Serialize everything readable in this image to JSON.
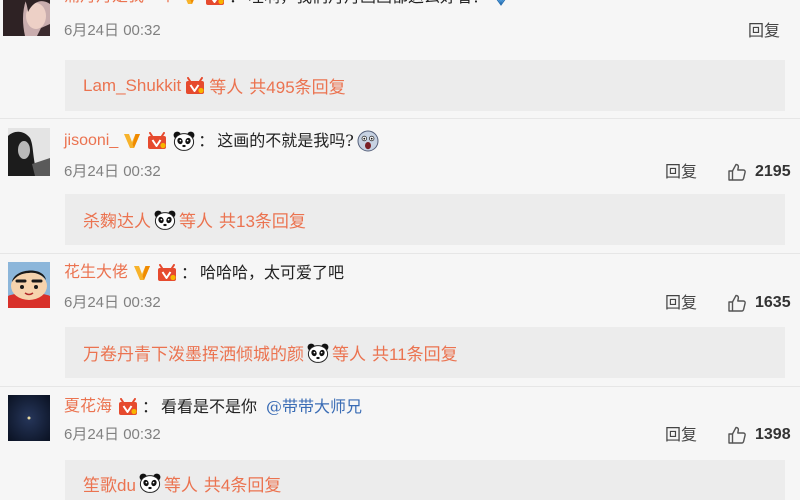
{
  "colors": {
    "page_bg": "#f6f6f6",
    "reply_box_bg": "#ececec",
    "username": "#eb7350",
    "text": "#222222",
    "meta": "#808080",
    "action": "#444444",
    "mention": "#3a6cb5"
  },
  "comments": [
    {
      "username": "蒲丹丹是我一个",
      "badges": [
        "verified-v-icon",
        "member-badge-icon"
      ],
      "separator": "：",
      "text": "哇啊，我们丹丹画画都这么好看！",
      "trailing_emoji": "diamond-emoji-icon",
      "date": "6月24日 00:32",
      "reply_label": "回复",
      "replies": {
        "first_user": "Lam_Shukkit",
        "first_user_badge": "member-badge-icon",
        "others_label": "等人",
        "count_label": "共495条回复"
      }
    },
    {
      "username": "jisooni_",
      "badges": [
        "verified-v-icon",
        "member-badge-icon",
        "panda-emoji-icon"
      ],
      "separator": "：",
      "text": "这画的不就是我吗?",
      "trailing_emoji": "shocked-face-emoji-icon",
      "date": "6月24日 00:32",
      "reply_label": "回复",
      "like_icon": "thumbs-up-icon",
      "likes": "2195",
      "replies": {
        "first_user": "杀麴达人",
        "first_user_badge": "panda-emoji-icon",
        "others_label": "等人",
        "count_label": "共13条回复"
      }
    },
    {
      "username": "花生大佬",
      "badges": [
        "verified-v-icon",
        "member-badge-icon"
      ],
      "separator": "：",
      "text": "哈哈哈，太可爱了吧",
      "date": "6月24日 00:32",
      "reply_label": "回复",
      "like_icon": "thumbs-up-icon",
      "likes": "1635",
      "replies": {
        "first_user": "万卷丹青下泼墨挥洒倾城的颜",
        "first_user_badge": "panda-emoji-icon",
        "others_label": "等人",
        "count_label": "共11条回复"
      }
    },
    {
      "username": "夏花海",
      "badges": [
        "member-badge-icon"
      ],
      "separator": "：",
      "text": "看看是不是你",
      "mention": "@带带大师兄",
      "date": "6月24日 00:32",
      "reply_label": "回复",
      "like_icon": "thumbs-up-icon",
      "likes": "1398",
      "replies": {
        "first_user": "笙歌du",
        "first_user_badge": "panda-emoji-icon",
        "others_label": "等人",
        "count_label": "共4条回复"
      }
    }
  ]
}
